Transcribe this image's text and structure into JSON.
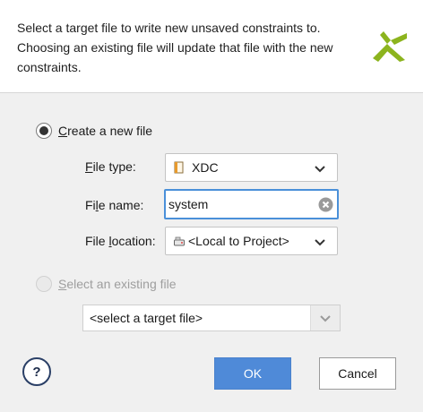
{
  "header": {
    "line1": "Select a target file to write new unsaved constraints to.",
    "line2": "Choosing an existing file will update that file with the new",
    "line3": "constraints."
  },
  "create_new": {
    "label_accel": "C",
    "label_rest": "reate a new file",
    "checked": true
  },
  "file_type": {
    "label_accel": "F",
    "label_rest": "ile type:",
    "value": "XDC",
    "icon": "file-icon"
  },
  "file_name": {
    "label_pre": "Fi",
    "label_accel": "l",
    "label_rest": "e name:",
    "value": "system"
  },
  "file_location": {
    "label_pre": "File ",
    "label_accel": "l",
    "label_rest": "ocation:",
    "value": "<Local to Project>",
    "icon": "drive-icon"
  },
  "select_existing": {
    "label_accel": "S",
    "label_rest": "elect an existing file",
    "checked": false,
    "enabled": false,
    "value": "<select a target file>"
  },
  "buttons": {
    "help": "?",
    "ok": "OK",
    "cancel": "Cancel"
  },
  "colors": {
    "accent": "#4f8ad8",
    "logo_green": "#8cb41e"
  }
}
